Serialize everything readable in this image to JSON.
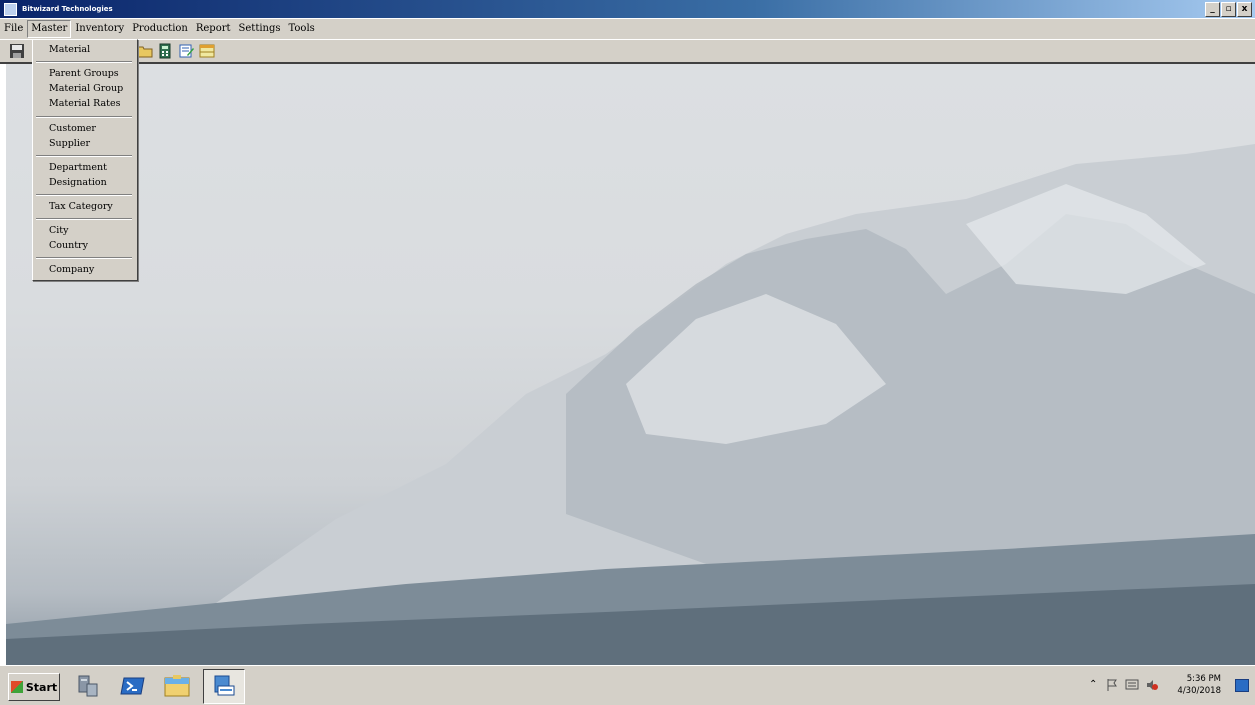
{
  "window": {
    "title": "Bitwizard Technologies",
    "minimize": "_",
    "restore": "▫",
    "close": "x"
  },
  "menubar": [
    "File",
    "Master",
    "Inventory",
    "Production",
    "Report",
    "Settings",
    "Tools"
  ],
  "master_menu": {
    "items": [
      "Material",
      "Parent Groups",
      "Material Group",
      "Material Rates",
      "Customer",
      "Supplier",
      "Department",
      "Designation",
      "Tax Category",
      "City",
      "Country",
      "Company"
    ]
  },
  "taskbar": {
    "start": "Start",
    "time": "5:36 PM",
    "date": "4/30/2018"
  },
  "icons": {
    "save": "save-icon",
    "folder": "folder-icon",
    "calculator": "calculator-icon",
    "notepad": "notepad-icon",
    "calendar": "calendar-icon",
    "server_manager": "server-manager-icon",
    "powershell": "powershell-icon",
    "explorer": "file-explorer-icon",
    "app": "app-icon"
  }
}
